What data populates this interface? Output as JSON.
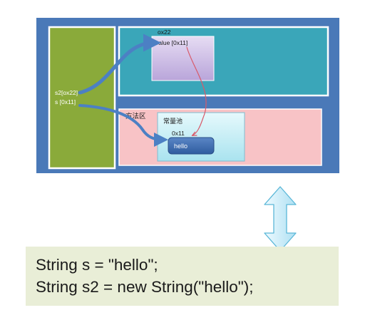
{
  "stack": {
    "var_s2": "s2[ox22]",
    "var_s": "s [0x11]"
  },
  "heap": {
    "object_address": "ox22",
    "object_field": "value [0x11]"
  },
  "method_area": {
    "label": "方法区",
    "pool_label": "常量池",
    "pool_address": "0x11",
    "pool_value": "hello"
  },
  "code": {
    "line1": "String s = \"hello\";",
    "line2": "String s2 = new String(\"hello\");"
  },
  "colors": {
    "outer_frame": "#4a79b8",
    "stack_area": "#8aaa3a",
    "heap_area": "#3aa6b9",
    "method_area": "#f8c3c6",
    "heap_object": "#c9b8e4",
    "pool_box": "#c4eff6",
    "pool_item": "#3f6fb4",
    "code_background": "#e9eed7",
    "double_arrow": "#c9ecf6"
  }
}
